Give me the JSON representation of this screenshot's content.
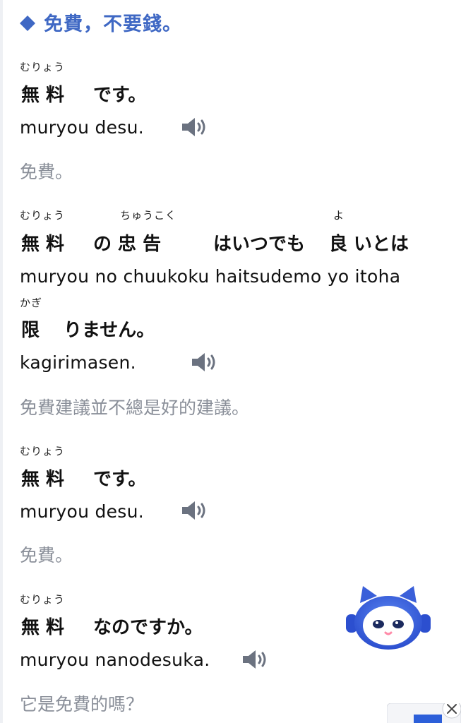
{
  "heading": {
    "text": "免費，不要錢。"
  },
  "sentences": [
    {
      "ruby": [
        "むりょう"
      ],
      "jp": [
        "無 料",
        "です。"
      ],
      "romaji": "muryou desu.",
      "translation": "免費。",
      "speaker_icon": "speaker-icon"
    },
    {
      "ruby": [
        "むりょう",
        "ちゅうこく",
        "よ"
      ],
      "jp": [
        "無 料",
        "の 忠 告",
        "はいつでも",
        "良 いとは"
      ],
      "romaji": "muryou no chuukoku haitsudemo yo itoha",
      "ruby2": [
        "かぎ"
      ],
      "jp2": [
        "限",
        "りません。"
      ],
      "romaji2": "kagirimasen.",
      "translation": "免費建議並不總是好的建議。",
      "speaker_icon": "speaker-icon"
    },
    {
      "ruby": [
        "むりょう"
      ],
      "jp": [
        "無 料",
        "です。"
      ],
      "romaji": "muryou desu.",
      "translation": "免費。",
      "speaker_icon": "speaker-icon"
    },
    {
      "ruby": [
        "むりょう"
      ],
      "jp": [
        "無 料",
        "なのですか。"
      ],
      "romaji": "muryou nanodesuka.",
      "translation": "它是免費的嗎？",
      "speaker_icon": "speaker-icon"
    }
  ],
  "colors": {
    "accent": "#3f68c4",
    "translation": "#8a8f99",
    "speaker": "#6b7280",
    "mascot": "#3a5fd9"
  },
  "icons": {
    "heading": "diamond-icon",
    "mascot": "robot-cat-mascot-icon",
    "close": "close-icon"
  }
}
